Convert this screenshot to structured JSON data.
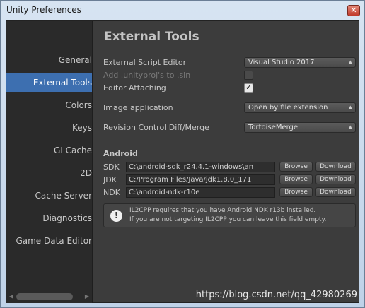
{
  "window": {
    "title": "Unity Preferences",
    "close_glyph": "✕"
  },
  "sidebar": {
    "items": [
      {
        "label": "General",
        "selected": false
      },
      {
        "label": "External Tools",
        "selected": true
      },
      {
        "label": "Colors",
        "selected": false
      },
      {
        "label": "Keys",
        "selected": false
      },
      {
        "label": "GI Cache",
        "selected": false
      },
      {
        "label": "2D",
        "selected": false
      },
      {
        "label": "Cache Server",
        "selected": false
      },
      {
        "label": "Diagnostics",
        "selected": false
      },
      {
        "label": "Game Data Editor",
        "selected": false
      }
    ]
  },
  "main": {
    "title": "External Tools",
    "external_script_editor": {
      "label": "External Script Editor",
      "value": "Visual Studio 2017"
    },
    "add_unityproj": {
      "label": "Add .unityproj's to .sln",
      "checked": false,
      "disabled": true
    },
    "editor_attaching": {
      "label": "Editor Attaching",
      "checked": true
    },
    "image_application": {
      "label": "Image application",
      "value": "Open by file extension"
    },
    "revision_control": {
      "label": "Revision Control Diff/Merge",
      "value": "TortoiseMerge"
    },
    "android": {
      "heading": "Android",
      "rows": [
        {
          "label": "SDK",
          "path": "C:\\android-sdk_r24.4.1-windows\\an",
          "browse": "Browse",
          "download": "Download"
        },
        {
          "label": "JDK",
          "path": "C:/Program Files/Java/jdk1.8.0_171",
          "browse": "Browse",
          "download": "Download"
        },
        {
          "label": "NDK",
          "path": "C:\\android-ndk-r10e",
          "browse": "Browse",
          "download": "Download"
        }
      ]
    },
    "info": {
      "icon": "!",
      "line1": "IL2CPP requires that you have Android NDK r13b installed.",
      "line2": "If you are not targeting IL2CPP you can leave this field empty."
    }
  },
  "watermark": "https://blog.csdn.net/qq_42980269",
  "colors": {
    "selected_bg": "#3d6fb0",
    "panel_bg": "#3c3c3c",
    "sidebar_bg": "#2a2a2a"
  }
}
